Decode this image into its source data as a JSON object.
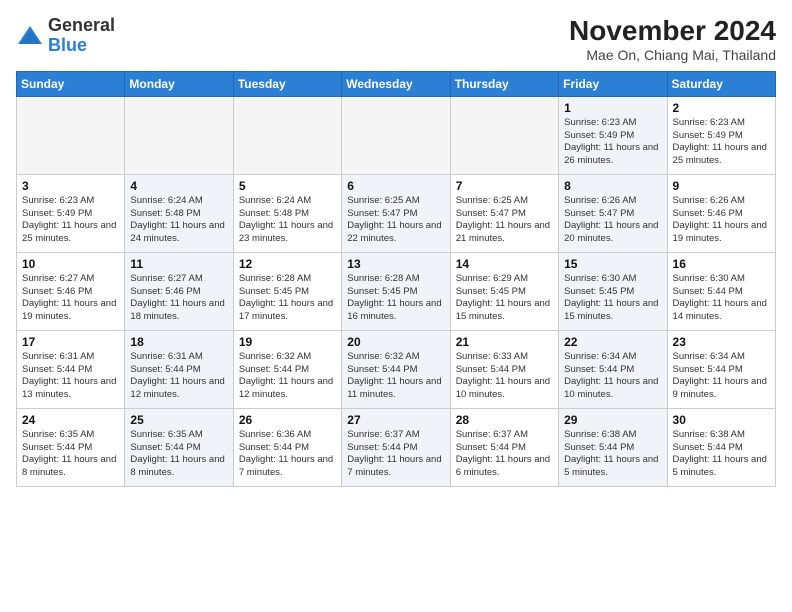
{
  "logo": {
    "general": "General",
    "blue": "Blue"
  },
  "title": "November 2024",
  "subtitle": "Mae On, Chiang Mai, Thailand",
  "weekdays": [
    "Sunday",
    "Monday",
    "Tuesday",
    "Wednesday",
    "Thursday",
    "Friday",
    "Saturday"
  ],
  "weeks": [
    [
      {
        "day": "",
        "info": "",
        "empty": true
      },
      {
        "day": "",
        "info": "",
        "empty": true
      },
      {
        "day": "",
        "info": "",
        "empty": true
      },
      {
        "day": "",
        "info": "",
        "empty": true
      },
      {
        "day": "",
        "info": "",
        "empty": true
      },
      {
        "day": "1",
        "info": "Sunrise: 6:23 AM\nSunset: 5:49 PM\nDaylight: 11 hours and 26 minutes.",
        "shaded": true
      },
      {
        "day": "2",
        "info": "Sunrise: 6:23 AM\nSunset: 5:49 PM\nDaylight: 11 hours and 25 minutes.",
        "shaded": false
      }
    ],
    [
      {
        "day": "3",
        "info": "Sunrise: 6:23 AM\nSunset: 5:49 PM\nDaylight: 11 hours and 25 minutes.",
        "shaded": false
      },
      {
        "day": "4",
        "info": "Sunrise: 6:24 AM\nSunset: 5:48 PM\nDaylight: 11 hours and 24 minutes.",
        "shaded": true
      },
      {
        "day": "5",
        "info": "Sunrise: 6:24 AM\nSunset: 5:48 PM\nDaylight: 11 hours and 23 minutes.",
        "shaded": false
      },
      {
        "day": "6",
        "info": "Sunrise: 6:25 AM\nSunset: 5:47 PM\nDaylight: 11 hours and 22 minutes.",
        "shaded": true
      },
      {
        "day": "7",
        "info": "Sunrise: 6:25 AM\nSunset: 5:47 PM\nDaylight: 11 hours and 21 minutes.",
        "shaded": false
      },
      {
        "day": "8",
        "info": "Sunrise: 6:26 AM\nSunset: 5:47 PM\nDaylight: 11 hours and 20 minutes.",
        "shaded": true
      },
      {
        "day": "9",
        "info": "Sunrise: 6:26 AM\nSunset: 5:46 PM\nDaylight: 11 hours and 19 minutes.",
        "shaded": false
      }
    ],
    [
      {
        "day": "10",
        "info": "Sunrise: 6:27 AM\nSunset: 5:46 PM\nDaylight: 11 hours and 19 minutes.",
        "shaded": false
      },
      {
        "day": "11",
        "info": "Sunrise: 6:27 AM\nSunset: 5:46 PM\nDaylight: 11 hours and 18 minutes.",
        "shaded": true
      },
      {
        "day": "12",
        "info": "Sunrise: 6:28 AM\nSunset: 5:45 PM\nDaylight: 11 hours and 17 minutes.",
        "shaded": false
      },
      {
        "day": "13",
        "info": "Sunrise: 6:28 AM\nSunset: 5:45 PM\nDaylight: 11 hours and 16 minutes.",
        "shaded": true
      },
      {
        "day": "14",
        "info": "Sunrise: 6:29 AM\nSunset: 5:45 PM\nDaylight: 11 hours and 15 minutes.",
        "shaded": false
      },
      {
        "day": "15",
        "info": "Sunrise: 6:30 AM\nSunset: 5:45 PM\nDaylight: 11 hours and 15 minutes.",
        "shaded": true
      },
      {
        "day": "16",
        "info": "Sunrise: 6:30 AM\nSunset: 5:44 PM\nDaylight: 11 hours and 14 minutes.",
        "shaded": false
      }
    ],
    [
      {
        "day": "17",
        "info": "Sunrise: 6:31 AM\nSunset: 5:44 PM\nDaylight: 11 hours and 13 minutes.",
        "shaded": false
      },
      {
        "day": "18",
        "info": "Sunrise: 6:31 AM\nSunset: 5:44 PM\nDaylight: 11 hours and 12 minutes.",
        "shaded": true
      },
      {
        "day": "19",
        "info": "Sunrise: 6:32 AM\nSunset: 5:44 PM\nDaylight: 11 hours and 12 minutes.",
        "shaded": false
      },
      {
        "day": "20",
        "info": "Sunrise: 6:32 AM\nSunset: 5:44 PM\nDaylight: 11 hours and 11 minutes.",
        "shaded": true
      },
      {
        "day": "21",
        "info": "Sunrise: 6:33 AM\nSunset: 5:44 PM\nDaylight: 11 hours and 10 minutes.",
        "shaded": false
      },
      {
        "day": "22",
        "info": "Sunrise: 6:34 AM\nSunset: 5:44 PM\nDaylight: 11 hours and 10 minutes.",
        "shaded": true
      },
      {
        "day": "23",
        "info": "Sunrise: 6:34 AM\nSunset: 5:44 PM\nDaylight: 11 hours and 9 minutes.",
        "shaded": false
      }
    ],
    [
      {
        "day": "24",
        "info": "Sunrise: 6:35 AM\nSunset: 5:44 PM\nDaylight: 11 hours and 8 minutes.",
        "shaded": false
      },
      {
        "day": "25",
        "info": "Sunrise: 6:35 AM\nSunset: 5:44 PM\nDaylight: 11 hours and 8 minutes.",
        "shaded": true
      },
      {
        "day": "26",
        "info": "Sunrise: 6:36 AM\nSunset: 5:44 PM\nDaylight: 11 hours and 7 minutes.",
        "shaded": false
      },
      {
        "day": "27",
        "info": "Sunrise: 6:37 AM\nSunset: 5:44 PM\nDaylight: 11 hours and 7 minutes.",
        "shaded": true
      },
      {
        "day": "28",
        "info": "Sunrise: 6:37 AM\nSunset: 5:44 PM\nDaylight: 11 hours and 6 minutes.",
        "shaded": false
      },
      {
        "day": "29",
        "info": "Sunrise: 6:38 AM\nSunset: 5:44 PM\nDaylight: 11 hours and 5 minutes.",
        "shaded": true
      },
      {
        "day": "30",
        "info": "Sunrise: 6:38 AM\nSunset: 5:44 PM\nDaylight: 11 hours and 5 minutes.",
        "shaded": false
      }
    ]
  ]
}
